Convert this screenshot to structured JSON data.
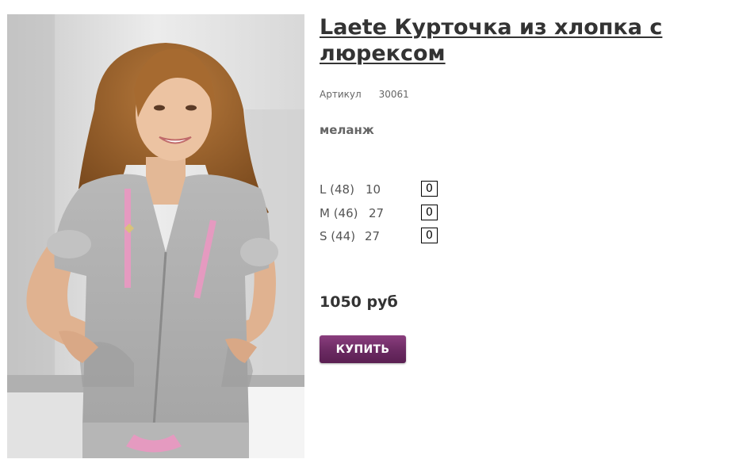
{
  "product": {
    "title": "Laete Курточка из хлопка с люрексом",
    "sku_label": "Артикул",
    "sku_value": "30061",
    "color": "меланж",
    "sizes": [
      {
        "label": "L (48)",
        "stock": "10",
        "qty": "0"
      },
      {
        "label": "M (46)",
        "stock": "27",
        "qty": "0"
      },
      {
        "label": "S (44)",
        "stock": "27",
        "qty": "0"
      }
    ],
    "price": "1050 руб",
    "buy_label": "КУПИТЬ"
  },
  "colors": {
    "button": "#6b2a62",
    "text": "#333333"
  }
}
